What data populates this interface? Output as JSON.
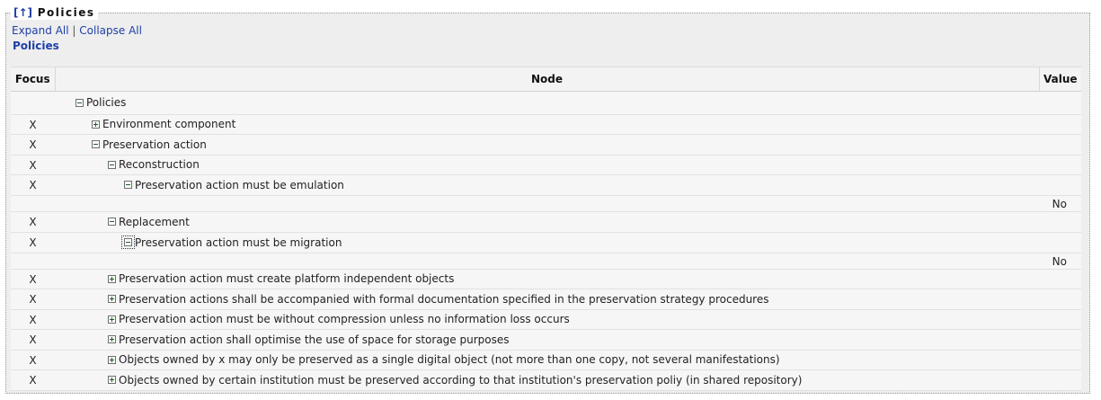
{
  "legend": {
    "arrow": "[↑]",
    "title": "Policies"
  },
  "links": {
    "expand_all": "Expand All",
    "separator": "|",
    "collapse_all": "Collapse All"
  },
  "breadcrumb": "Policies",
  "table": {
    "headers": {
      "focus": "Focus",
      "node": "Node",
      "value": "Value"
    },
    "rows": [
      {
        "focus": "",
        "indent": 1,
        "toggle": "minus",
        "label": "Policies",
        "value": ""
      },
      {
        "focus": "X",
        "indent": 2,
        "toggle": "plus",
        "label": "Environment component",
        "value": ""
      },
      {
        "focus": "X",
        "indent": 2,
        "toggle": "minus",
        "label": "Preservation action",
        "value": ""
      },
      {
        "focus": "X",
        "indent": 3,
        "toggle": "minus",
        "label": "Reconstruction",
        "value": ""
      },
      {
        "focus": "X",
        "indent": 4,
        "toggle": "minus",
        "label": "Preservation action must be emulation",
        "value": ""
      },
      {
        "focus": "",
        "indent": 0,
        "toggle": "",
        "label": "",
        "value": "No"
      },
      {
        "focus": "X",
        "indent": 3,
        "toggle": "minus",
        "label": "Replacement",
        "value": ""
      },
      {
        "focus": "X",
        "indent": 4,
        "toggle": "minus",
        "label": "Preservation action must be migration",
        "value": "",
        "focused": true
      },
      {
        "focus": "",
        "indent": 0,
        "toggle": "",
        "label": "",
        "value": "No"
      },
      {
        "focus": "X",
        "indent": 3,
        "toggle": "plus",
        "label": "Preservation action must create platform independent objects",
        "value": ""
      },
      {
        "focus": "X",
        "indent": 3,
        "toggle": "plus",
        "label": "Preservation actions shall be accompanied with formal documentation specified in the preservation strategy procedures",
        "value": ""
      },
      {
        "focus": "X",
        "indent": 3,
        "toggle": "plus",
        "label": "Preservation action must be without compression unless no information loss occurs",
        "value": ""
      },
      {
        "focus": "X",
        "indent": 3,
        "toggle": "plus",
        "label": "Preservation action shall optimise the use of space for storage purposes",
        "value": ""
      },
      {
        "focus": "X",
        "indent": 3,
        "toggle": "plus",
        "label": "Objects owned by x may only be preserved as a single digital object (not more than one copy, not several manifestations)",
        "value": ""
      },
      {
        "focus": "X",
        "indent": 3,
        "toggle": "plus",
        "label": "Objects owned by certain institution must be preserved according to that institution's preservation poliy (in shared repository)",
        "value": ""
      }
    ]
  }
}
